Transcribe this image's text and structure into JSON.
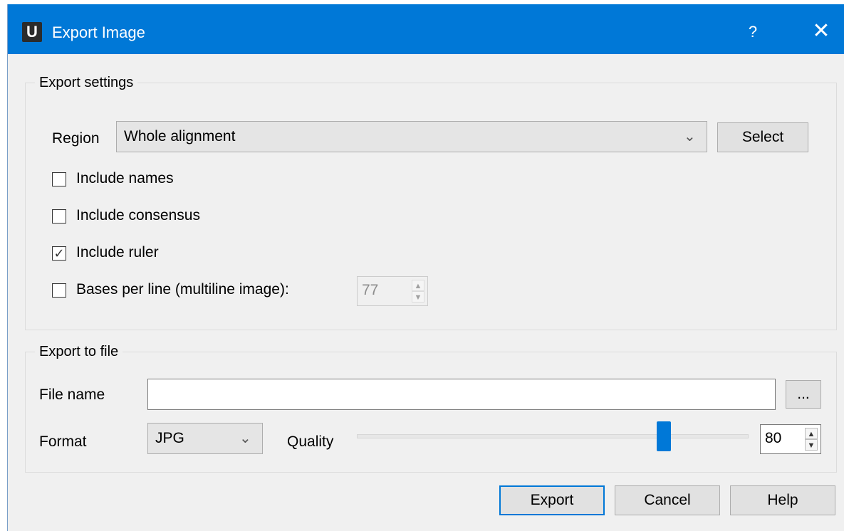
{
  "window": {
    "title": "Export Image",
    "app_icon_letter": "U",
    "help_glyph": "?",
    "close_glyph": "✕"
  },
  "export_settings": {
    "group_title": "Export settings",
    "region_label": "Region",
    "region_value": "Whole alignment",
    "select_button": "Select",
    "include_names": {
      "label": "Include names",
      "checked": false
    },
    "include_consensus": {
      "label": "Include consensus",
      "checked": false
    },
    "include_ruler": {
      "label": "Include ruler",
      "checked": true
    },
    "bases_per_line": {
      "label": "Bases per line (multiline image):",
      "checked": false,
      "value": "77"
    }
  },
  "export_to_file": {
    "group_title": "Export to file",
    "file_name_label": "File name",
    "file_name_value": "",
    "browse_button": "...",
    "format_label": "Format",
    "format_value": "JPG",
    "quality_label": "Quality",
    "quality_value": "80",
    "quality_fraction": 0.8
  },
  "footer": {
    "export_button": "Export",
    "cancel_button": "Cancel",
    "help_button": "Help"
  },
  "colors": {
    "titlebar": "#0078d7",
    "accent": "#0078d7",
    "dialog_bg": "#f0f0f0"
  },
  "icons": {
    "dropdown": "chevron-down-icon",
    "checkmark": "checkmark-icon",
    "spin_up": "arrow-up-icon",
    "spin_down": "arrow-down-icon"
  }
}
